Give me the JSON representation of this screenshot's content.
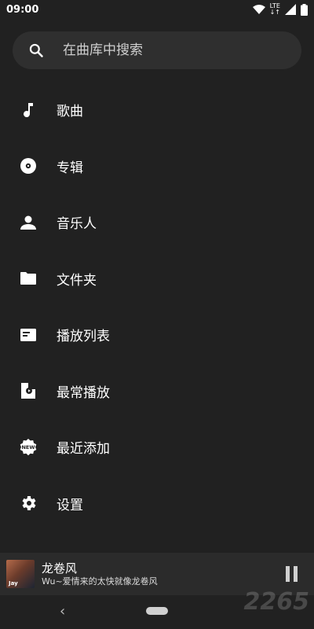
{
  "status_bar": {
    "time": "09:00",
    "network": "LTE"
  },
  "search": {
    "placeholder": "在曲库中搜索",
    "icon": "search-icon"
  },
  "menu": [
    {
      "label": "歌曲",
      "icon": "music-note-icon"
    },
    {
      "label": "专辑",
      "icon": "album-disc-icon"
    },
    {
      "label": "音乐人",
      "icon": "person-icon"
    },
    {
      "label": "文件夹",
      "icon": "folder-icon"
    },
    {
      "label": "播放列表",
      "icon": "playlist-icon"
    },
    {
      "label": "最常播放",
      "icon": "most-played-icon"
    },
    {
      "label": "最近添加",
      "icon": "new-badge-icon"
    },
    {
      "label": "设置",
      "icon": "gear-icon"
    }
  ],
  "now_playing": {
    "title": "龙卷风",
    "subtitle": "Wu~爱情来的太快就像龙卷风",
    "album_art_text": "Jay"
  },
  "watermark": "2265",
  "colors": {
    "background": "#212121",
    "search_bg": "#2f2f2f",
    "player_bg": "#2b2b2b",
    "text": "#ffffff"
  }
}
